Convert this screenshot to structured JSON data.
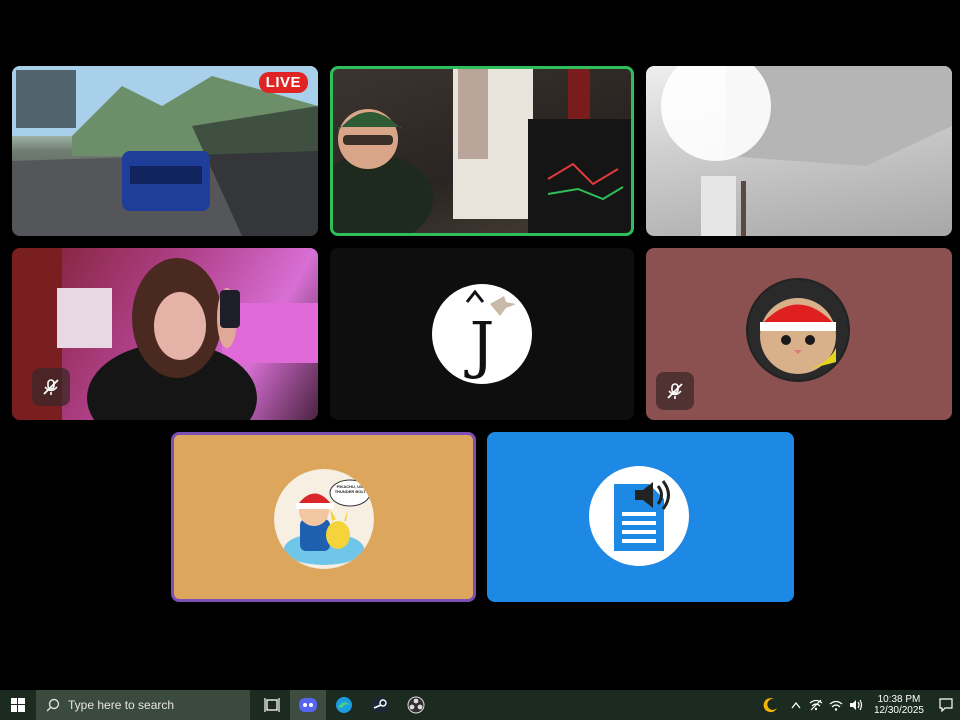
{
  "tiles": {
    "game": {
      "badge": "LIVE"
    }
  },
  "avatars": {
    "j_letter": "J",
    "speech_bubble": "PIKACHU, USE THUNDER BOLT!"
  },
  "taskbar": {
    "search_placeholder": "Type here to search",
    "time": "10:38 PM",
    "date": "12/30/2025"
  },
  "colors": {
    "active_speaker_border": "#2fbf5a",
    "pinned_border": "#7b4fb3",
    "cat_tile": "#8b5050",
    "ash_tile": "#dca65c",
    "doc_tile": "#1e88e5"
  },
  "icons": [
    "windows-start-icon",
    "search-icon",
    "task-view-icon",
    "discord-icon",
    "edge-icon",
    "steam-icon",
    "obs-icon",
    "moon-icon",
    "chevron-up-icon",
    "wifi-off-icon",
    "volume-icon",
    "notification-icon",
    "mic-muted-icon"
  ]
}
